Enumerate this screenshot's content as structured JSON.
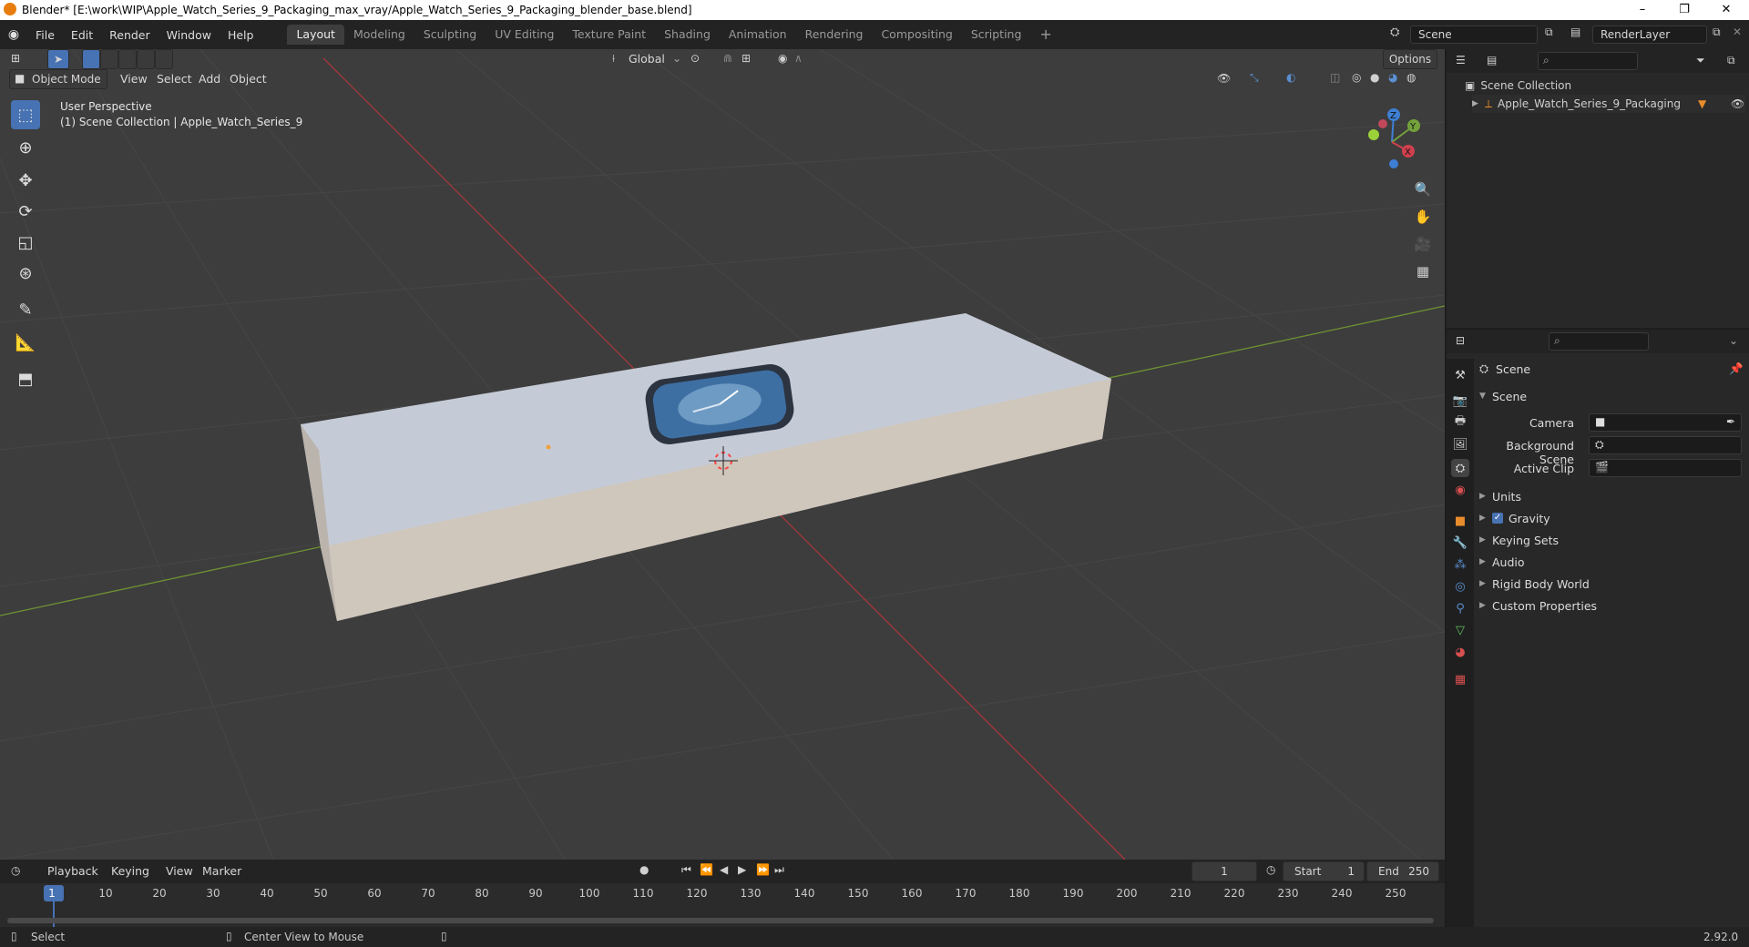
{
  "window": {
    "title": "Blender* [E:\\work\\WIP\\Apple_Watch_Series_9_Packaging_max_vray/Apple_Watch_Series_9_Packaging_blender_base.blend]",
    "minimize": "–",
    "restore": "❐",
    "close": "✕"
  },
  "menu": {
    "items": [
      "File",
      "Edit",
      "Render",
      "Window",
      "Help"
    ]
  },
  "workspaces": {
    "tabs": [
      "Layout",
      "Modeling",
      "Sculpting",
      "UV Editing",
      "Texture Paint",
      "Shading",
      "Animation",
      "Rendering",
      "Compositing",
      "Scripting"
    ],
    "active": "Layout",
    "add": "+"
  },
  "scene_selector": {
    "value": "Scene"
  },
  "renderlayer_selector": {
    "value": "RenderLayer"
  },
  "viewport_header": {
    "mode": "Object Mode",
    "menus": [
      "View",
      "Select",
      "Add",
      "Object"
    ],
    "transform_orientation": "Global",
    "options": "Options"
  },
  "viewport": {
    "perspective": "User Perspective",
    "collection_info": "(1) Scene Collection | Apple_Watch_Series_9",
    "gizmo": {
      "x": "X",
      "y": "Y",
      "z": "Z"
    }
  },
  "outliner": {
    "root": "Scene Collection",
    "object": "Apple_Watch_Series_9_Packaging"
  },
  "properties": {
    "context": "Scene",
    "panel": "Scene",
    "camera_label": "Camera",
    "background_scene_label": "Background Scene",
    "active_clip_label": "Active Clip",
    "subpanels": [
      "Units",
      "Gravity",
      "Keying Sets",
      "Audio",
      "Rigid Body World",
      "Custom Properties"
    ],
    "gravity_checked": true
  },
  "timeline": {
    "menus": [
      "Playback",
      "Keying",
      "View",
      "Marker"
    ],
    "current_frame": "1",
    "start_label": "Start",
    "start": "1",
    "end_label": "End",
    "end": "250",
    "ruler": [
      "1",
      "10",
      "20",
      "30",
      "40",
      "50",
      "60",
      "70",
      "80",
      "90",
      "100",
      "110",
      "120",
      "130",
      "140",
      "150",
      "160",
      "170",
      "180",
      "190",
      "200",
      "210",
      "220",
      "230",
      "240",
      "250"
    ]
  },
  "statusbar": {
    "select": "Select",
    "center_view": "Center View to Mouse",
    "version": "2.92.0"
  }
}
